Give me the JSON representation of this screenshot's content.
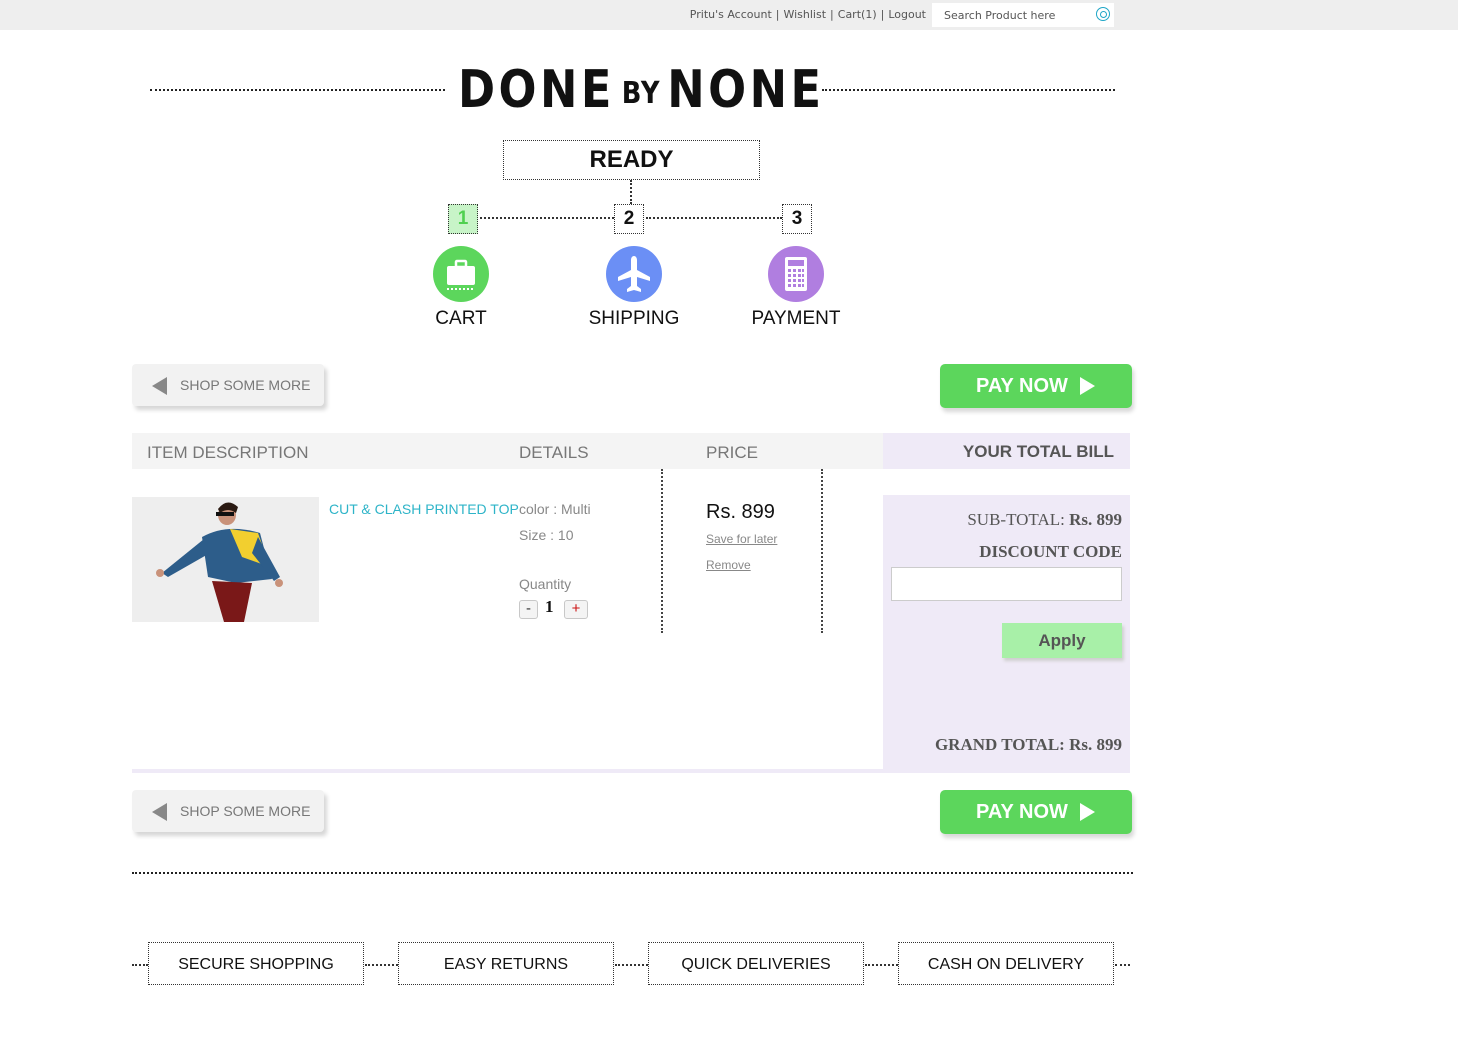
{
  "topbar": {
    "links": [
      "Pritu's Account",
      "Wishlist",
      "Cart(1)",
      "Logout"
    ],
    "separator": "|",
    "search_placeholder": "Search Product here"
  },
  "logo": {
    "part1": "DONE",
    "part2": "BY",
    "part3": "NONE"
  },
  "checkout": {
    "status": "READY",
    "steps": [
      {
        "number": "1",
        "label": "CART",
        "icon": "suitcase-icon",
        "color": "#5cd65c",
        "active": true
      },
      {
        "number": "2",
        "label": "SHIPPING",
        "icon": "airplane-icon",
        "color": "#6b8ff5",
        "active": false
      },
      {
        "number": "3",
        "label": "PAYMENT",
        "icon": "calculator-icon",
        "color": "#b07ee0",
        "active": false
      }
    ]
  },
  "actions": {
    "shop_more": "SHOP SOME MORE",
    "pay_now": "PAY NOW"
  },
  "table": {
    "headers": {
      "item": "ITEM DESCRIPTION",
      "details": "DETAILS",
      "price": "PRICE",
      "bill": "YOUR TOTAL BILL"
    }
  },
  "item": {
    "name": "CUT & CLASH PRINTED TOP",
    "color_label": "color : Multi",
    "size_label": "Size : 10",
    "quantity_label": "Quantity",
    "quantity": "1",
    "minus": "-",
    "plus": "+",
    "price": "Rs. 899",
    "save_for_later": "Save for later",
    "remove": "Remove"
  },
  "bill": {
    "subtotal_label": "SUB-TOTAL:",
    "subtotal_value": "Rs. 899",
    "discount_label": "DISCOUNT CODE",
    "apply": "Apply",
    "grand_label": "GRAND TOTAL:",
    "grand_value": "Rs. 899"
  },
  "features": [
    "SECURE SHOPPING",
    "EASY RETURNS",
    "QUICK DELIVERIES",
    "CASH ON DELIVERY"
  ]
}
